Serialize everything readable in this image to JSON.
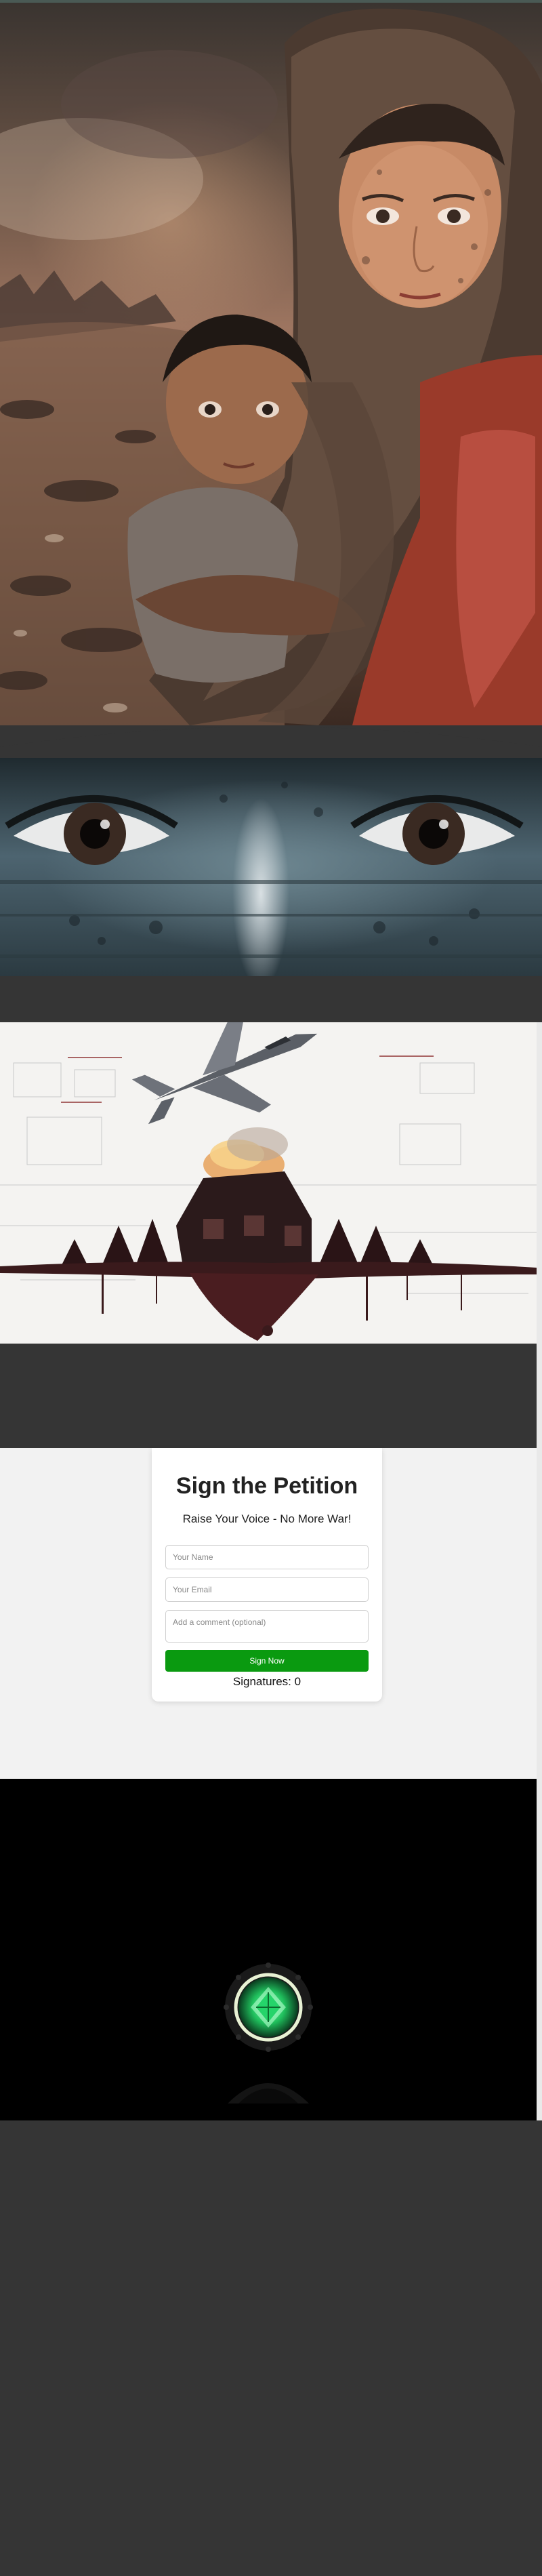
{
  "petition": {
    "title": "Sign the Petition",
    "subtitle": "Raise Your Voice - No More War!",
    "name_placeholder": "Your Name",
    "email_placeholder": "Your Email",
    "comment_placeholder": "Add a comment (optional)",
    "submit_label": "Sign Now",
    "signatures_label": "Signatures:",
    "signatures_count": "0"
  },
  "colors": {
    "page_background": "#353535",
    "button_green": "#0a9a10",
    "card_background": "#ffffff",
    "section_background": "#f2f2f2",
    "logo_green": "#27d36a"
  },
  "icons": {
    "emblem": "green-diamond-emblem-icon"
  }
}
